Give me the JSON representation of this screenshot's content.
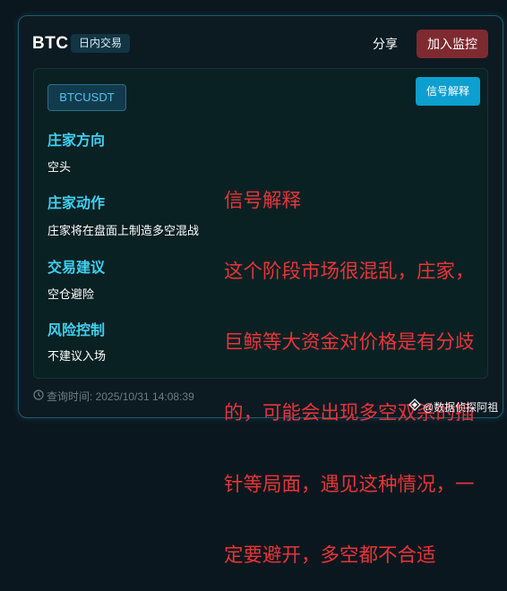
{
  "header": {
    "coin": "BTC",
    "timeframe_tag": "日内交易",
    "share_label": "分享",
    "add_watch_label": "加入监控"
  },
  "panel": {
    "symbol": "BTCUSDT",
    "explain_label": "信号解释",
    "sections": [
      {
        "title": "庄家方向",
        "text": "空头"
      },
      {
        "title": "庄家动作",
        "text": "庄家将在盘面上制造多空混战"
      },
      {
        "title": "交易建议",
        "text": "空仓避险"
      },
      {
        "title": "风险控制",
        "text": "不建议入场"
      }
    ]
  },
  "annotation": {
    "lines": [
      "信号解释",
      "这个阶段市场很混乱，庄家，",
      "巨鲸等大资金对价格是有分歧",
      "的，可能会出现多空双杀的插",
      "针等局面，遇见这种情况，一",
      "定要避开，多空都不合适"
    ],
    "color": "#e6353a"
  },
  "footer": {
    "query_time": "查询时间: 2025/10/31 14:08:39"
  },
  "watermark": {
    "text": "@数据侦探阿祖",
    "icon": "diamond-logo-icon"
  },
  "colors": {
    "accent": "#0d9fd0",
    "section_title": "#3fd0f0",
    "add_button": "#7e2a31"
  }
}
